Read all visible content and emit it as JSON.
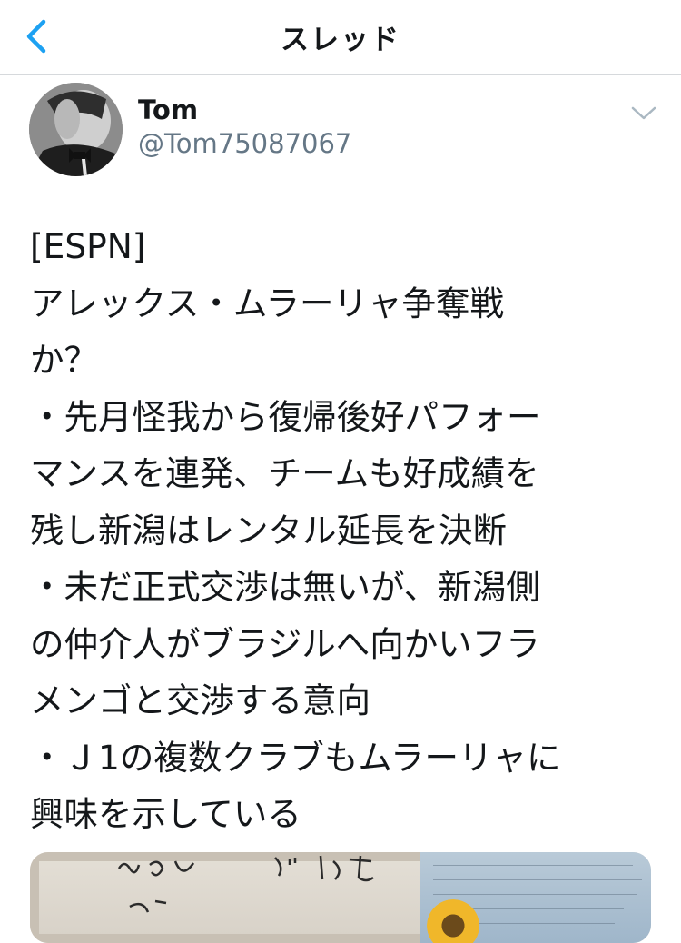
{
  "navbar": {
    "title": "スレッド"
  },
  "tweet": {
    "author_name": "Tom",
    "author_handle": "@Tom75087067",
    "lines": [
      "[ESPN]",
      "アレックス・ムラーリャ争奪戦",
      "か？",
      "・先月怪我から復帰後好パフォー",
      "マンスを連発、チームも好成績を",
      "残し新潟はレンタル延長を決断",
      "・未だ正式交渉は無いが、新潟側",
      "の仲介人がブラジルへ向かいフラ",
      "メンゴと交渉する意向",
      "・Ｊ1の複数クラブもムラーリャに",
      "興味を示している"
    ]
  },
  "colors": {
    "accent": "#1da1f2",
    "text_primary": "#14171a",
    "text_secondary": "#657786",
    "divider": "#d6d9dc"
  },
  "icons": {
    "back": "back-arrow-icon",
    "more": "chevron-down-icon"
  }
}
